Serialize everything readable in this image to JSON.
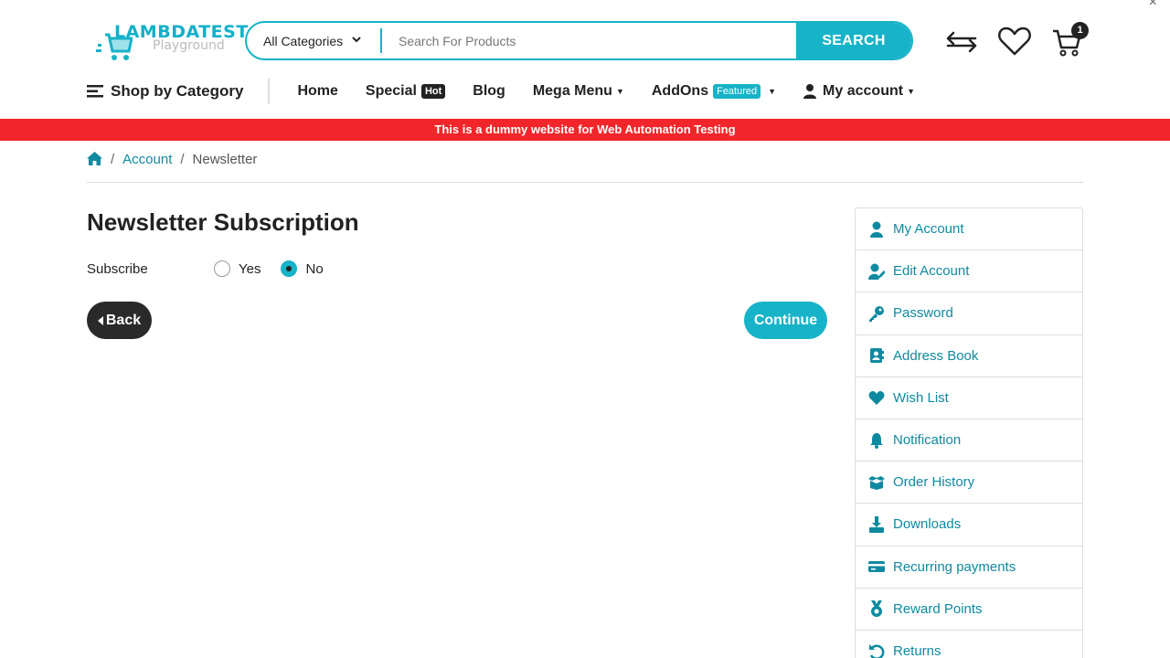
{
  "colors": {
    "accent": "#17b3c8",
    "link": "#0e8aa0",
    "banner": "#f2262a",
    "dark": "#222222"
  },
  "logo": {
    "title": "LAMBDATEST",
    "subtitle": "Playground"
  },
  "search": {
    "category": "All Categories",
    "placeholder": "Search For Products",
    "value": "",
    "button": "SEARCH"
  },
  "header": {
    "cart_count": "1",
    "close": "×"
  },
  "nav": {
    "shop_by_category": "Shop by Category",
    "items": [
      {
        "label": "Home"
      },
      {
        "label": "Special",
        "badge": "Hot"
      },
      {
        "label": "Blog"
      },
      {
        "label": "Mega Menu"
      },
      {
        "label": "AddOns",
        "badge": "Featured"
      },
      {
        "label": "My account"
      }
    ]
  },
  "banner": "This is a dummy website for Web Automation Testing",
  "breadcrumb": {
    "account": "Account",
    "current": "Newsletter",
    "sep": "/"
  },
  "main": {
    "title": "Newsletter Subscription",
    "subscribe_label": "Subscribe",
    "options": [
      {
        "label": "Yes",
        "checked": false
      },
      {
        "label": "No",
        "checked": true
      }
    ],
    "back": "Back",
    "continue": "Continue"
  },
  "sidebar": {
    "items": [
      {
        "label": "My Account",
        "icon": "user-icon"
      },
      {
        "label": "Edit Account",
        "icon": "user-edit-icon"
      },
      {
        "label": "Password",
        "icon": "key-icon"
      },
      {
        "label": "Address Book",
        "icon": "address-book-icon"
      },
      {
        "label": "Wish List",
        "icon": "heart-icon"
      },
      {
        "label": "Notification",
        "icon": "bell-icon"
      },
      {
        "label": "Order History",
        "icon": "box-icon"
      },
      {
        "label": "Downloads",
        "icon": "download-icon"
      },
      {
        "label": "Recurring payments",
        "icon": "credit-card-icon"
      },
      {
        "label": "Reward Points",
        "icon": "medal-icon"
      },
      {
        "label": "Returns",
        "icon": "undo-icon"
      }
    ]
  }
}
